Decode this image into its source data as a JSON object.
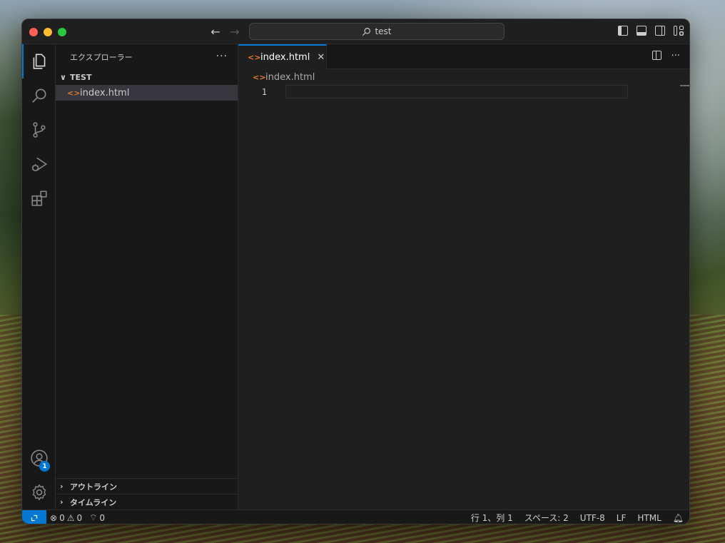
{
  "titlebar": {
    "search_text": "test",
    "back_icon": "arrow-left-icon",
    "forward_icon": "arrow-right-icon"
  },
  "activitybar": {
    "items": [
      "explorer-icon",
      "search-icon",
      "source-control-icon",
      "run-debug-icon",
      "extensions-icon"
    ],
    "accounts_badge": "1"
  },
  "sidebar": {
    "title": "エクスプローラー",
    "more": "···",
    "folder": "TEST",
    "files": [
      {
        "name": "index.html",
        "icon": "<>"
      }
    ],
    "outline": "アウトライン",
    "timeline": "タイムライン"
  },
  "editor": {
    "tab_label": "index.html",
    "tab_icon": "<>",
    "tab_close": "✕",
    "more": "···",
    "breadcrumb": "index.html",
    "line_number": "1"
  },
  "statusbar": {
    "errors": "0",
    "warnings": "0",
    "ports": "0",
    "position": "行 1、列 1",
    "spaces": "スペース: 2",
    "encoding": "UTF-8",
    "eol": "LF",
    "language": "HTML"
  },
  "colors": {
    "accent": "#0078d4",
    "html_icon": "#e37933",
    "background": "#1f1f1f",
    "sidebar": "#181818"
  }
}
